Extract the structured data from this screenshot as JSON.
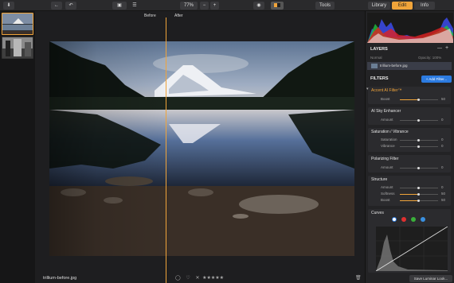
{
  "toolbar": {
    "zoom": "77%",
    "tools": "Tools",
    "tabs": [
      "Library",
      "Edit",
      "Info"
    ]
  },
  "compare": {
    "before": "Before",
    "after": "After"
  },
  "footer": {
    "filename": "trillium-before.jpg",
    "save_look": "Save Luminar Look..."
  },
  "layers": {
    "title": "LAYERS",
    "blend_mode": "Normal",
    "opacity": "Opacity: 100%",
    "layer_name": "trillium-before.jpg"
  },
  "filters": {
    "title": "FILTERS",
    "add_button": "+ Add Filter...",
    "accent": {
      "name": "Accent AI Filter™",
      "sliders": [
        {
          "label": "Boost",
          "value": "50"
        }
      ]
    },
    "ai_sky": {
      "name": "AI Sky Enhancer",
      "sliders": [
        {
          "label": "Amount",
          "value": "0"
        }
      ]
    },
    "saturation": {
      "name": "Saturation / Vibrance",
      "sliders": [
        {
          "label": "Saturation",
          "value": "0"
        },
        {
          "label": "Vibrance",
          "value": "0"
        }
      ]
    },
    "polarizing": {
      "name": "Polarizing Filter",
      "sliders": [
        {
          "label": "Amount",
          "value": "0"
        }
      ]
    },
    "structure": {
      "name": "Structure",
      "sliders": [
        {
          "label": "Amount",
          "value": "0"
        },
        {
          "label": "Softness",
          "value": "50"
        },
        {
          "label": "Boost",
          "value": "50"
        }
      ]
    },
    "curves": {
      "name": "Curves"
    }
  },
  "colors": {
    "accent": "#f0a43a",
    "active_blue": "#2c7be0"
  }
}
